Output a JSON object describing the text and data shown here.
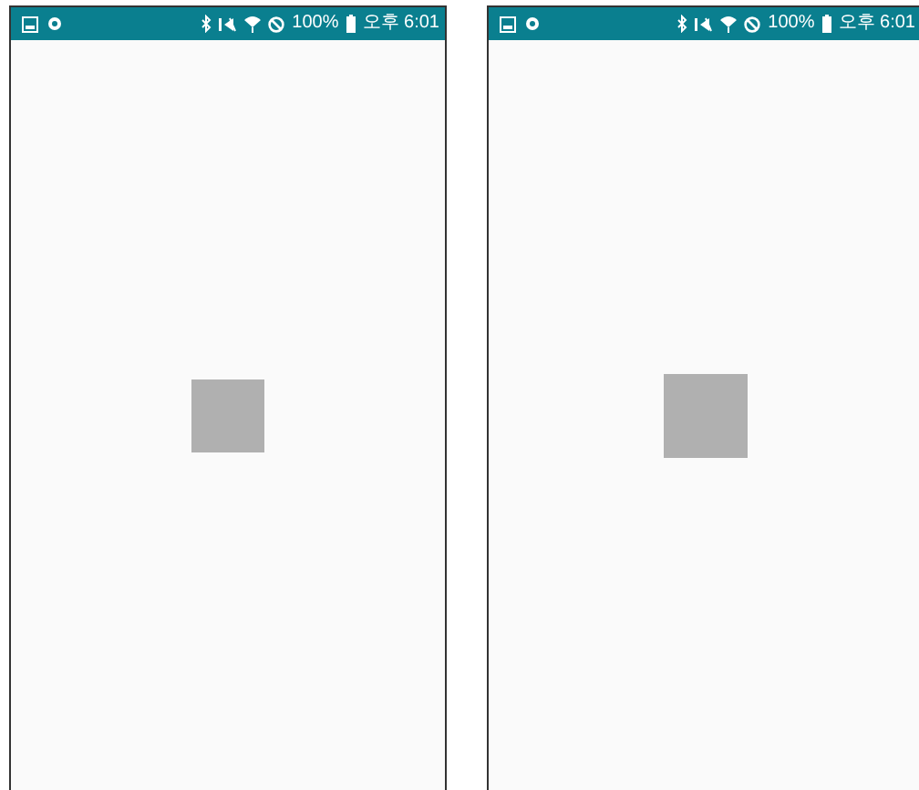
{
  "phones": [
    {
      "status_bar": {
        "battery": "100%",
        "time": "오후 6:01"
      }
    },
    {
      "status_bar": {
        "battery": "100%",
        "time": "오후 6:01"
      }
    }
  ]
}
